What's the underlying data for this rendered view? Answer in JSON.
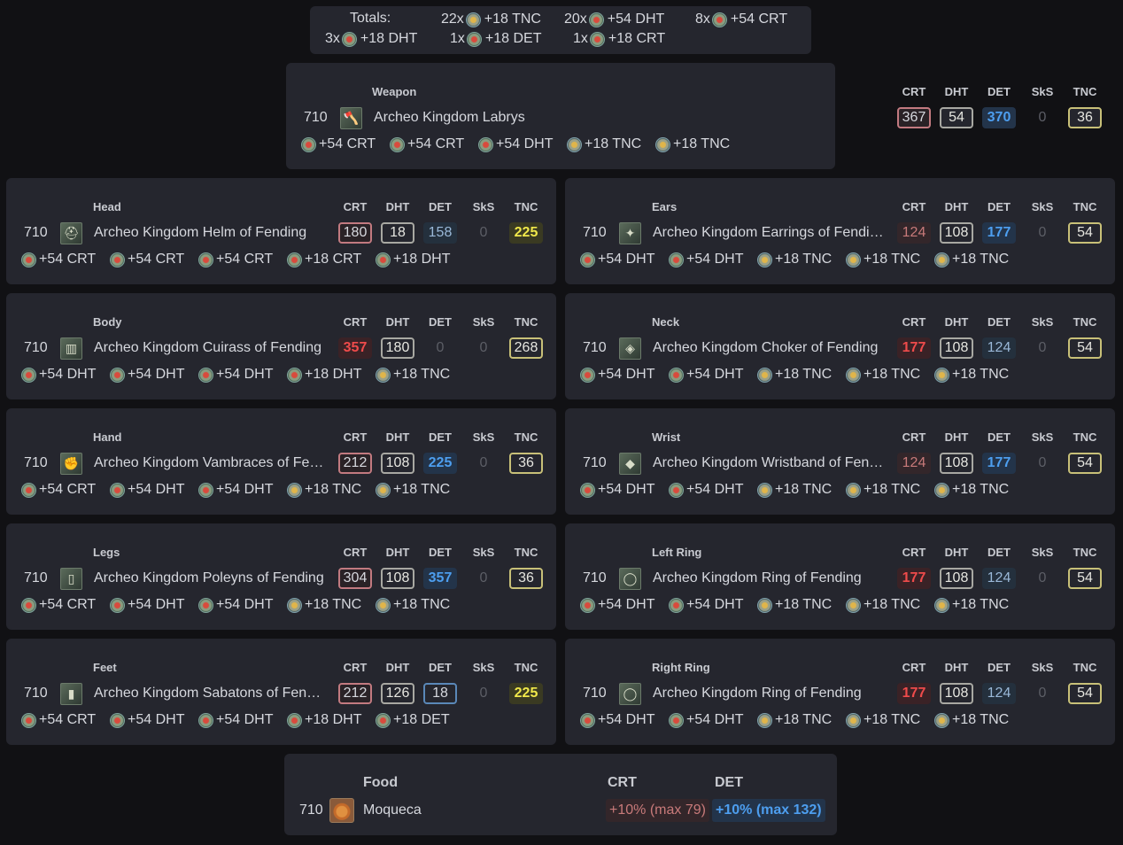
{
  "totals": {
    "label": "Totals:",
    "entries": [
      {
        "count": "22x",
        "icon": "gold",
        "text": "+18 TNC"
      },
      {
        "count": "20x",
        "icon": "red",
        "text": "+54 DHT"
      },
      {
        "count": "8x",
        "icon": "red",
        "text": "+54 CRT"
      },
      {
        "count": "3x",
        "icon": "red",
        "text": "+18 DHT"
      },
      {
        "count": "1x",
        "icon": "red",
        "text": "+18 DET"
      },
      {
        "count": "1x",
        "icon": "red",
        "text": "+18 CRT"
      }
    ]
  },
  "headers": [
    "CRT",
    "DHT",
    "DET",
    "SkS",
    "TNC"
  ],
  "weapon": {
    "slot": "Weapon",
    "ilvl": "710",
    "name": "Archeo Kingdom Labrys",
    "icon": "axe-icon",
    "stats": [
      {
        "v": "367",
        "s": "cap"
      },
      {
        "v": "54",
        "s": "full"
      },
      {
        "v": "370",
        "s": "det-b"
      },
      {
        "v": "0",
        "s": "zero"
      },
      {
        "v": "36",
        "s": "tnc"
      }
    ],
    "melds": [
      {
        "i": "red",
        "t": "+54 CRT"
      },
      {
        "i": "red",
        "t": "+54 CRT"
      },
      {
        "i": "red",
        "t": "+54 DHT"
      },
      {
        "i": "gold",
        "t": "+18 TNC"
      },
      {
        "i": "gold",
        "t": "+18 TNC"
      }
    ]
  },
  "gear": [
    {
      "slot": "Head",
      "ilvl": "710",
      "name": "Archeo Kingdom Helm of Fending",
      "icon": "helm-icon",
      "stats": [
        {
          "v": "180",
          "s": "cap"
        },
        {
          "v": "18",
          "s": "full"
        },
        {
          "v": "158",
          "s": "det"
        },
        {
          "v": "0",
          "s": "zero"
        },
        {
          "v": "225",
          "s": "gold"
        }
      ],
      "melds": [
        {
          "i": "red",
          "t": "+54 CRT"
        },
        {
          "i": "red",
          "t": "+54 CRT"
        },
        {
          "i": "red",
          "t": "+54 CRT"
        },
        {
          "i": "red",
          "t": "+18 CRT"
        },
        {
          "i": "red",
          "t": "+18 DHT"
        }
      ]
    },
    {
      "slot": "Ears",
      "ilvl": "710",
      "name": "Archeo Kingdom Earrings of Fending",
      "icon": "earring-icon",
      "stats": [
        {
          "v": "124",
          "s": "redl"
        },
        {
          "v": "108",
          "s": "full"
        },
        {
          "v": "177",
          "s": "det-b"
        },
        {
          "v": "0",
          "s": "zero"
        },
        {
          "v": "54",
          "s": "tnc"
        }
      ],
      "melds": [
        {
          "i": "red",
          "t": "+54 DHT"
        },
        {
          "i": "red",
          "t": "+54 DHT"
        },
        {
          "i": "gold",
          "t": "+18 TNC"
        },
        {
          "i": "gold",
          "t": "+18 TNC"
        },
        {
          "i": "gold",
          "t": "+18 TNC"
        }
      ]
    },
    {
      "slot": "Body",
      "ilvl": "710",
      "name": "Archeo Kingdom Cuirass of Fending",
      "icon": "cuirass-icon",
      "stats": [
        {
          "v": "357",
          "s": "red"
        },
        {
          "v": "180",
          "s": "full"
        },
        {
          "v": "0",
          "s": "zero"
        },
        {
          "v": "0",
          "s": "zero"
        },
        {
          "v": "268",
          "s": "tnc"
        }
      ],
      "melds": [
        {
          "i": "red",
          "t": "+54 DHT"
        },
        {
          "i": "red",
          "t": "+54 DHT"
        },
        {
          "i": "red",
          "t": "+54 DHT"
        },
        {
          "i": "red",
          "t": "+18 DHT"
        },
        {
          "i": "gold",
          "t": "+18 TNC"
        }
      ]
    },
    {
      "slot": "Neck",
      "ilvl": "710",
      "name": "Archeo Kingdom Choker of Fending",
      "icon": "choker-icon",
      "stats": [
        {
          "v": "177",
          "s": "red"
        },
        {
          "v": "108",
          "s": "full"
        },
        {
          "v": "124",
          "s": "det"
        },
        {
          "v": "0",
          "s": "zero"
        },
        {
          "v": "54",
          "s": "tnc"
        }
      ],
      "melds": [
        {
          "i": "red",
          "t": "+54 DHT"
        },
        {
          "i": "red",
          "t": "+54 DHT"
        },
        {
          "i": "gold",
          "t": "+18 TNC"
        },
        {
          "i": "gold",
          "t": "+18 TNC"
        },
        {
          "i": "gold",
          "t": "+18 TNC"
        }
      ]
    },
    {
      "slot": "Hand",
      "ilvl": "710",
      "name": "Archeo Kingdom Vambraces of Fending",
      "icon": "vambraces-icon",
      "stats": [
        {
          "v": "212",
          "s": "cap"
        },
        {
          "v": "108",
          "s": "full"
        },
        {
          "v": "225",
          "s": "det-b"
        },
        {
          "v": "0",
          "s": "zero"
        },
        {
          "v": "36",
          "s": "tnc"
        }
      ],
      "melds": [
        {
          "i": "red",
          "t": "+54 CRT"
        },
        {
          "i": "red",
          "t": "+54 DHT"
        },
        {
          "i": "red",
          "t": "+54 DHT"
        },
        {
          "i": "gold",
          "t": "+18 TNC"
        },
        {
          "i": "gold",
          "t": "+18 TNC"
        }
      ]
    },
    {
      "slot": "Wrist",
      "ilvl": "710",
      "name": "Archeo Kingdom Wristband of Fending",
      "icon": "wristband-icon",
      "stats": [
        {
          "v": "124",
          "s": "redl"
        },
        {
          "v": "108",
          "s": "full"
        },
        {
          "v": "177",
          "s": "det-b"
        },
        {
          "v": "0",
          "s": "zero"
        },
        {
          "v": "54",
          "s": "tnc"
        }
      ],
      "melds": [
        {
          "i": "red",
          "t": "+54 DHT"
        },
        {
          "i": "red",
          "t": "+54 DHT"
        },
        {
          "i": "gold",
          "t": "+18 TNC"
        },
        {
          "i": "gold",
          "t": "+18 TNC"
        },
        {
          "i": "gold",
          "t": "+18 TNC"
        }
      ]
    },
    {
      "slot": "Legs",
      "ilvl": "710",
      "name": "Archeo Kingdom Poleyns of Fending",
      "icon": "poleyns-icon",
      "stats": [
        {
          "v": "304",
          "s": "cap"
        },
        {
          "v": "108",
          "s": "full"
        },
        {
          "v": "357",
          "s": "det-b"
        },
        {
          "v": "0",
          "s": "zero"
        },
        {
          "v": "36",
          "s": "tnc"
        }
      ],
      "melds": [
        {
          "i": "red",
          "t": "+54 CRT"
        },
        {
          "i": "red",
          "t": "+54 DHT"
        },
        {
          "i": "red",
          "t": "+54 DHT"
        },
        {
          "i": "gold",
          "t": "+18 TNC"
        },
        {
          "i": "gold",
          "t": "+18 TNC"
        }
      ]
    },
    {
      "slot": "Left Ring",
      "ilvl": "710",
      "name": "Archeo Kingdom Ring of Fending",
      "icon": "ring-icon",
      "stats": [
        {
          "v": "177",
          "s": "red"
        },
        {
          "v": "108",
          "s": "full"
        },
        {
          "v": "124",
          "s": "det"
        },
        {
          "v": "0",
          "s": "zero"
        },
        {
          "v": "54",
          "s": "tnc"
        }
      ],
      "melds": [
        {
          "i": "red",
          "t": "+54 DHT"
        },
        {
          "i": "red",
          "t": "+54 DHT"
        },
        {
          "i": "gold",
          "t": "+18 TNC"
        },
        {
          "i": "gold",
          "t": "+18 TNC"
        },
        {
          "i": "gold",
          "t": "+18 TNC"
        }
      ]
    },
    {
      "slot": "Feet",
      "ilvl": "710",
      "name": "Archeo Kingdom Sabatons of Fending",
      "icon": "sabatons-icon",
      "stats": [
        {
          "v": "212",
          "s": "cap"
        },
        {
          "v": "126",
          "s": "full"
        },
        {
          "v": "18",
          "s": "det-bx"
        },
        {
          "v": "0",
          "s": "zero"
        },
        {
          "v": "225",
          "s": "gold"
        }
      ],
      "melds": [
        {
          "i": "red",
          "t": "+54 CRT"
        },
        {
          "i": "red",
          "t": "+54 DHT"
        },
        {
          "i": "red",
          "t": "+54 DHT"
        },
        {
          "i": "red",
          "t": "+18 DHT"
        },
        {
          "i": "red",
          "t": "+18 DET"
        }
      ]
    },
    {
      "slot": "Right Ring",
      "ilvl": "710",
      "name": "Archeo Kingdom Ring of Fending",
      "icon": "ring-icon",
      "stats": [
        {
          "v": "177",
          "s": "red"
        },
        {
          "v": "108",
          "s": "full"
        },
        {
          "v": "124",
          "s": "det"
        },
        {
          "v": "0",
          "s": "zero"
        },
        {
          "v": "54",
          "s": "tnc"
        }
      ],
      "melds": [
        {
          "i": "red",
          "t": "+54 DHT"
        },
        {
          "i": "red",
          "t": "+54 DHT"
        },
        {
          "i": "gold",
          "t": "+18 TNC"
        },
        {
          "i": "gold",
          "t": "+18 TNC"
        },
        {
          "i": "gold",
          "t": "+18 TNC"
        }
      ]
    }
  ],
  "food": {
    "slot": "Food",
    "ilvl": "710",
    "name": "Moqueca",
    "icon": "food-bowl-icon",
    "crt_header": "CRT",
    "det_header": "DET",
    "crt_value": "+10% (max 79)",
    "det_value": "+10% (max 132)"
  }
}
